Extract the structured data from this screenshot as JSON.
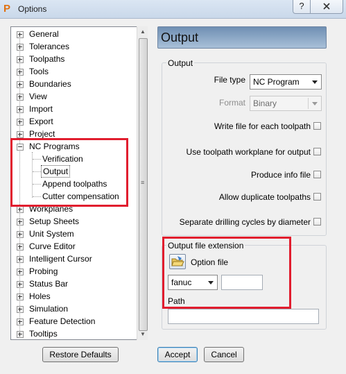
{
  "window": {
    "title": "Options",
    "help_label": "?",
    "app_icon": "P"
  },
  "tree": {
    "items": [
      {
        "label": "General",
        "expandable": true
      },
      {
        "label": "Tolerances",
        "expandable": true
      },
      {
        "label": "Toolpaths",
        "expandable": true
      },
      {
        "label": "Tools",
        "expandable": true
      },
      {
        "label": "Boundaries",
        "expandable": true
      },
      {
        "label": "View",
        "expandable": true
      },
      {
        "label": "Import",
        "expandable": true
      },
      {
        "label": "Export",
        "expandable": true
      },
      {
        "label": "Project",
        "expandable": true
      },
      {
        "label": "NC Programs",
        "expandable": true,
        "expanded": true
      },
      {
        "label": "Verification",
        "child": true
      },
      {
        "label": "Output",
        "child": true,
        "selected": true
      },
      {
        "label": "Append toolpaths",
        "child": true
      },
      {
        "label": "Cutter compensation",
        "child": true
      },
      {
        "label": "Workplanes",
        "expandable": true
      },
      {
        "label": "Setup Sheets",
        "expandable": true
      },
      {
        "label": "Unit System",
        "expandable": true
      },
      {
        "label": "Curve Editor",
        "expandable": true
      },
      {
        "label": "Intelligent Cursor",
        "expandable": true
      },
      {
        "label": "Probing",
        "expandable": true
      },
      {
        "label": "Status Bar",
        "expandable": true
      },
      {
        "label": "Holes",
        "expandable": true
      },
      {
        "label": "Simulation",
        "expandable": true
      },
      {
        "label": "Feature Detection",
        "expandable": true
      },
      {
        "label": "Tooltips",
        "expandable": true
      }
    ]
  },
  "panel": {
    "title": "Output",
    "output_group": {
      "legend": "Output",
      "file_type_label": "File type",
      "file_type_value": "NC Program",
      "format_label": "Format",
      "format_value": "Binary",
      "checkboxes": [
        {
          "label": "Write file for each toolpath",
          "checked": false
        },
        {
          "label": "Use toolpath workplane for output",
          "checked": false
        },
        {
          "label": "Produce info file",
          "checked": false
        },
        {
          "label": "Allow duplicate toolpaths",
          "checked": false
        },
        {
          "label": "Separate drilling cycles by diameter",
          "checked": false
        }
      ]
    },
    "extension_group": {
      "legend": "Output file extension",
      "option_file_label": "Option file",
      "controller_value": "fanuc",
      "extension_value": "",
      "path_label": "Path",
      "path_value": ""
    }
  },
  "buttons": {
    "restore_defaults": "Restore Defaults",
    "accept": "Accept",
    "cancel": "Cancel"
  },
  "highlight_color": "#e11d2e"
}
